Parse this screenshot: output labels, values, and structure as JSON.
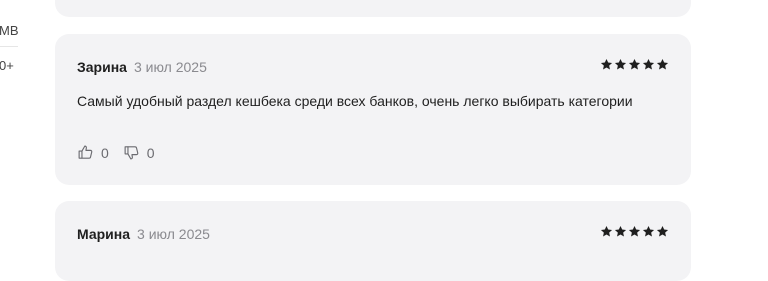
{
  "sidebar": {
    "items": [
      {
        "label": "МВ"
      },
      {
        "label": "0+"
      }
    ]
  },
  "reviews": [
    {
      "author": "Зарина",
      "date": "3 июл 2025",
      "rating": 5,
      "text": "Самый удобный раздел кешбека среди всех банков, очень легко выбирать категории",
      "likes": "0",
      "dislikes": "0"
    },
    {
      "author": "Марина",
      "date": "3 июл 2025",
      "rating": 5
    }
  ],
  "colors": {
    "card_bg": "#f3f3f5",
    "star": "#1f1f1f",
    "date": "#8a8a8f"
  }
}
